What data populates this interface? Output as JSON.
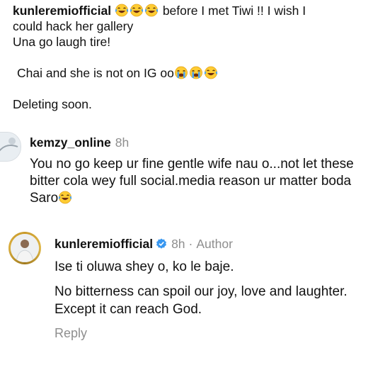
{
  "caption": {
    "handle": "kunleremiofficial",
    "line1_text": " before I met Tiwi !! I wish I",
    "line2": "could hack her gallery",
    "line3": "Una go laugh tire!",
    "line4_text": "Chai and she is not on IG oo",
    "line5": "Deleting soon."
  },
  "comments": [
    {
      "username": "kemzy_online",
      "time": "8h",
      "text": "You no go keep ur fine gentle wife nau o...not let these bitter cola wey full social.media reason ur matter boda Saro",
      "emoji_icon": "laughing-tears-emoji"
    },
    {
      "username": "kunleremiofficial",
      "time": "8h",
      "separator": "·",
      "role": "Author",
      "paragraph1": "Ise ti oluwa shey o, ko le baje.",
      "paragraph2": "No bitterness can spoil our joy, love and laughter. Except it can reach God.",
      "reply_label": "Reply"
    }
  ],
  "colors": {
    "text": "#111111",
    "secondary": "#8e8e8e",
    "verified": "#3897f0",
    "emoji_face": "#ffcc33",
    "tears": "#4aa3f0"
  }
}
